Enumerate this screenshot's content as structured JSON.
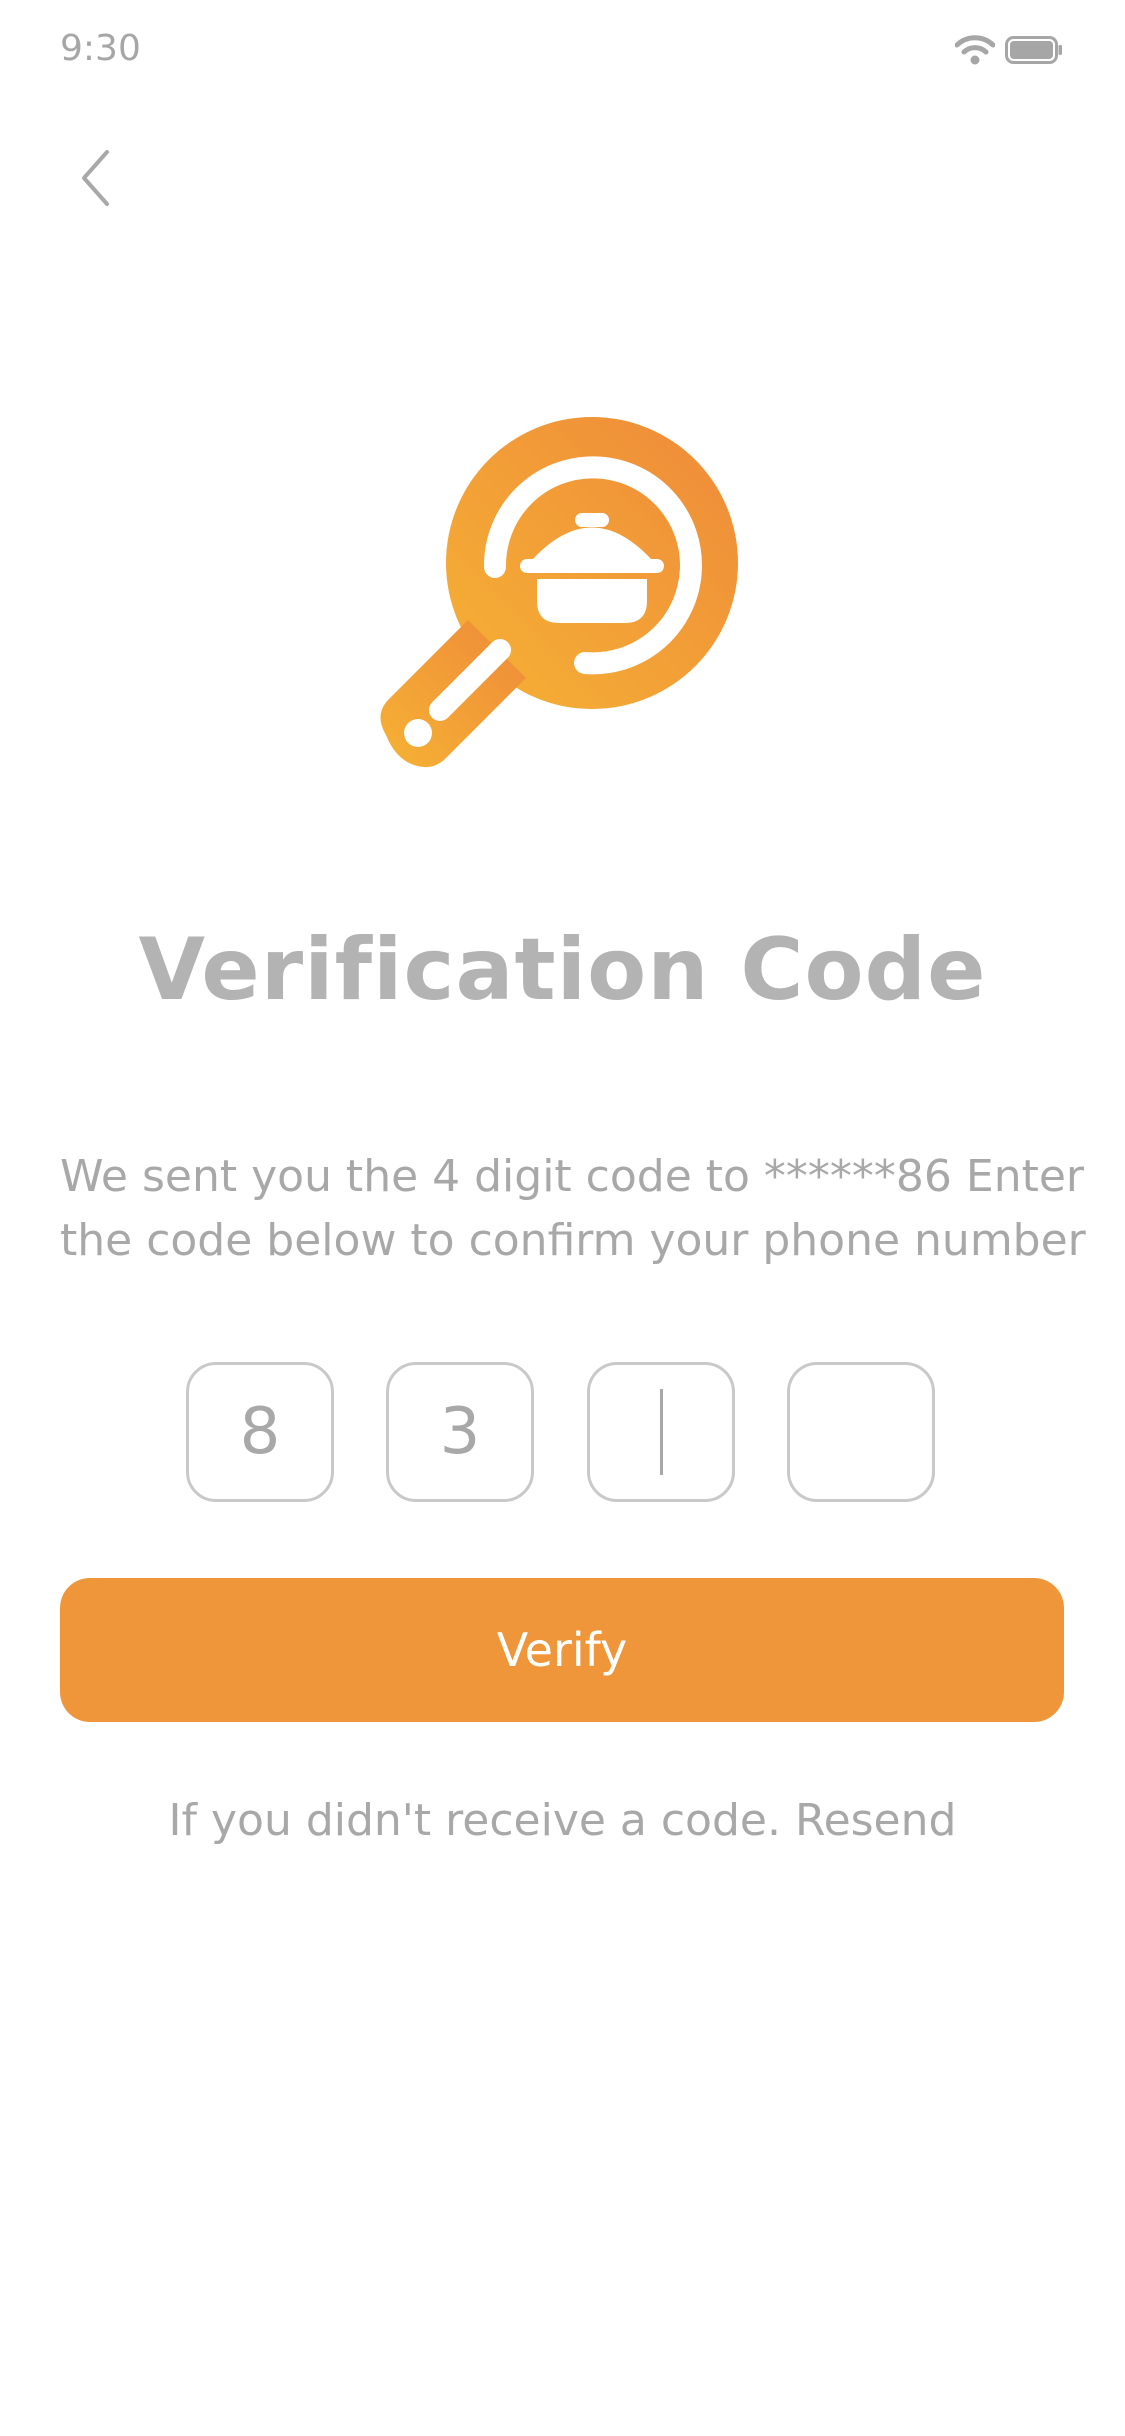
{
  "status_bar": {
    "time": "9:30",
    "icons": [
      "wifi-icon",
      "battery-icon"
    ]
  },
  "navigation": {
    "back_icon": "chevron-left-icon"
  },
  "logo": {
    "icon": "frying-pan-pot-logo",
    "gradient_start": "#f5b234",
    "gradient_end": "#ef8a3a"
  },
  "title": "Verification Code",
  "description": {
    "line1": "We sent you the 4 digit code to ******86 Enter",
    "line2": "the code below to confirm your phone number"
  },
  "code_inputs": [
    {
      "value": "8"
    },
    {
      "value": "3"
    },
    {
      "value": ""
    },
    {
      "value": ""
    }
  ],
  "verify_button": {
    "label": "Verify",
    "color": "#ef963a"
  },
  "resend": {
    "prompt": "If you didn't receive a code.",
    "link_label": "Resend"
  }
}
